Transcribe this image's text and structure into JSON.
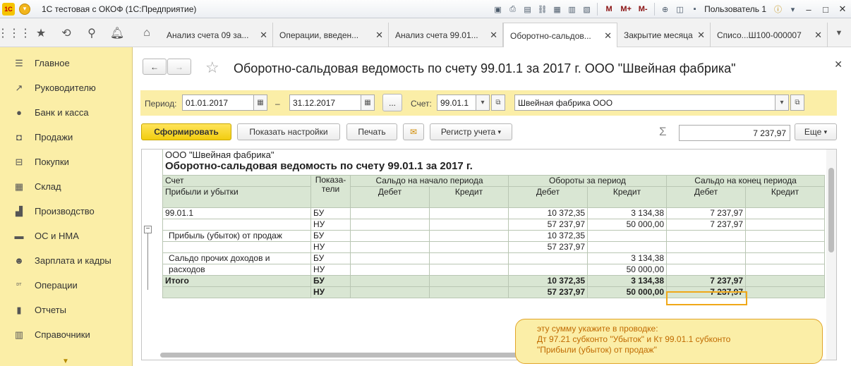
{
  "titlebar": {
    "logo": "1С",
    "title": "1С тестовая с ОКОФ  (1С:Предприятие)",
    "m_buttons": [
      "M",
      "M+",
      "M-"
    ],
    "user": "Пользователь 1"
  },
  "tabs": [
    {
      "label": "Анализ счета 09 за..."
    },
    {
      "label": "Операции, введен..."
    },
    {
      "label": "Анализ счета 99.01..."
    },
    {
      "label": "Оборотно-сальдов..."
    },
    {
      "label": "Закрытие месяца"
    },
    {
      "label": "Списо...Ш100-000007"
    }
  ],
  "sidebar": {
    "items": [
      {
        "label": "Главное",
        "icon": "menu-lines-icon"
      },
      {
        "label": "Руководителю",
        "icon": "trend-chart-icon"
      },
      {
        "label": "Банк и касса",
        "icon": "ruble-coin-icon"
      },
      {
        "label": "Продажи",
        "icon": "shopping-bag-icon"
      },
      {
        "label": "Покупки",
        "icon": "shopping-cart-icon"
      },
      {
        "label": "Склад",
        "icon": "warehouse-grid-icon"
      },
      {
        "label": "Производство",
        "icon": "factory-icon"
      },
      {
        "label": "ОС и НМА",
        "icon": "truck-icon"
      },
      {
        "label": "Зарплата и кадры",
        "icon": "people-icon"
      },
      {
        "label": "Операции",
        "icon": "dt-kt-icon"
      },
      {
        "label": "Отчеты",
        "icon": "bar-chart-icon"
      },
      {
        "label": "Справочники",
        "icon": "books-icon"
      }
    ]
  },
  "form": {
    "title": "Оборотно-сальдовая ведомость по счету 99.01.1 за 2017 г. ООО \"Швейная фабрика\"",
    "params": {
      "period_label": "Период:",
      "date_from": "01.01.2017",
      "dash": "–",
      "date_to": "31.12.2017",
      "ellipsis": "...",
      "account_label": "Счет:",
      "account": "99.01.1",
      "organization": "Швейная фабрика ООО"
    },
    "toolbar": {
      "generate": "Сформировать",
      "show_settings": "Показать настройки",
      "print": "Печать",
      "register": "Регистр учета",
      "more": "Еще",
      "sigma": "Σ",
      "total": "7 237,97"
    }
  },
  "report": {
    "org": "ООО \"Швейная фабрика\"",
    "title": "Оборотно-сальдовая ведомость по счету 99.01.1 за 2017 г.",
    "headers": {
      "account": "Счет",
      "subconto": "Прибыли и убытки",
      "indicators": "Показа-\nтели",
      "opening": "Сальдо на начало периода",
      "turnover": "Обороты за период",
      "closing": "Сальдо на конец периода",
      "debit": "Дебет",
      "credit": "Кредит"
    },
    "rows": [
      {
        "name": "99.01.1",
        "ind": "БУ",
        "td": "10 372,35",
        "tc": "3 134,38",
        "cd": "7 237,97"
      },
      {
        "name": "",
        "ind": "НУ",
        "td": "57 237,97",
        "tc": "50 000,00",
        "cd": "7 237,97"
      },
      {
        "name": "Прибыль (убыток) от продаж",
        "ind": "БУ",
        "td": "10 372,35",
        "tc": "",
        "cd": ""
      },
      {
        "name": "",
        "ind": "НУ",
        "td": "57 237,97",
        "tc": "",
        "cd": ""
      },
      {
        "name": "Сальдо прочих доходов и",
        "ind": "БУ",
        "td": "",
        "tc": "3 134,38",
        "cd": ""
      },
      {
        "name": "расходов",
        "ind": "НУ",
        "td": "",
        "tc": "50 000,00",
        "cd": ""
      }
    ],
    "totals": [
      {
        "name": "Итого",
        "ind": "БУ",
        "td": "10 372,35",
        "tc": "3 134,38",
        "cd": "7 237,97"
      },
      {
        "name": "",
        "ind": "НУ",
        "td": "57 237,97",
        "tc": "50 000,00",
        "cd": "7 237,97"
      }
    ]
  },
  "callout": {
    "line1": "эту сумму укажите в проводке:",
    "line2": "Дт 97.21 субконто \"Убыток\" и Кт 99.01.1 субконто",
    "line3": "\"Прибыли (убыток) от продаж\""
  }
}
